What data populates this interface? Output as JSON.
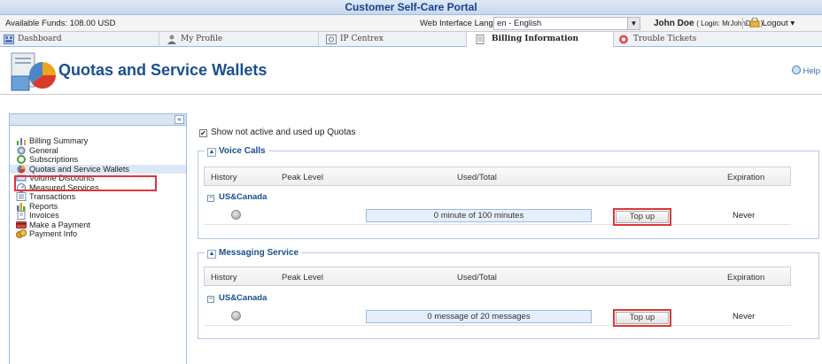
{
  "app": {
    "title": "Customer Self-Care Portal"
  },
  "infobar": {
    "funds": "Available Funds: 108.00 USD",
    "language_label": "Web Interface Language:",
    "language_value": "en - English",
    "user_name": "John Doe",
    "user_login": "( Login: MrJohnDoe )",
    "logout": "Logout"
  },
  "tabs": [
    {
      "label": "Dashboard"
    },
    {
      "label": "My Profile"
    },
    {
      "label": "IP Centrex"
    },
    {
      "label": "Billing Information"
    },
    {
      "label": "Trouble Tickets"
    }
  ],
  "header": {
    "title": "Quotas and Service Wallets",
    "help": "Help"
  },
  "sidebar": {
    "collapse": "«",
    "items": [
      {
        "label": "Billing Summary"
      },
      {
        "label": "General"
      },
      {
        "label": "Subscriptions"
      },
      {
        "label": "Quotas and Service Wallets"
      },
      {
        "label": "Volume Discounts"
      },
      {
        "label": "Measured Services"
      },
      {
        "label": "Transactions"
      },
      {
        "label": "Reports"
      },
      {
        "label": "Invoices"
      },
      {
        "label": "Make a Payment"
      },
      {
        "label": "Payment Info"
      }
    ]
  },
  "main": {
    "show_toggle": "Show not active and used up Quotas",
    "columns": {
      "history": "History",
      "peak": "Peak Level",
      "used": "Used/Total",
      "expiration": "Expiration"
    },
    "panels": [
      {
        "title": "Voice Calls",
        "group": "US&Canada",
        "usage": "0 minute of 100 minutes",
        "button": "Top up",
        "expiration": "Never"
      },
      {
        "title": "Messaging Service",
        "group": "US&Canada",
        "usage": "0 message of 20 messages",
        "button": "Top up",
        "expiration": "Never"
      }
    ]
  }
}
